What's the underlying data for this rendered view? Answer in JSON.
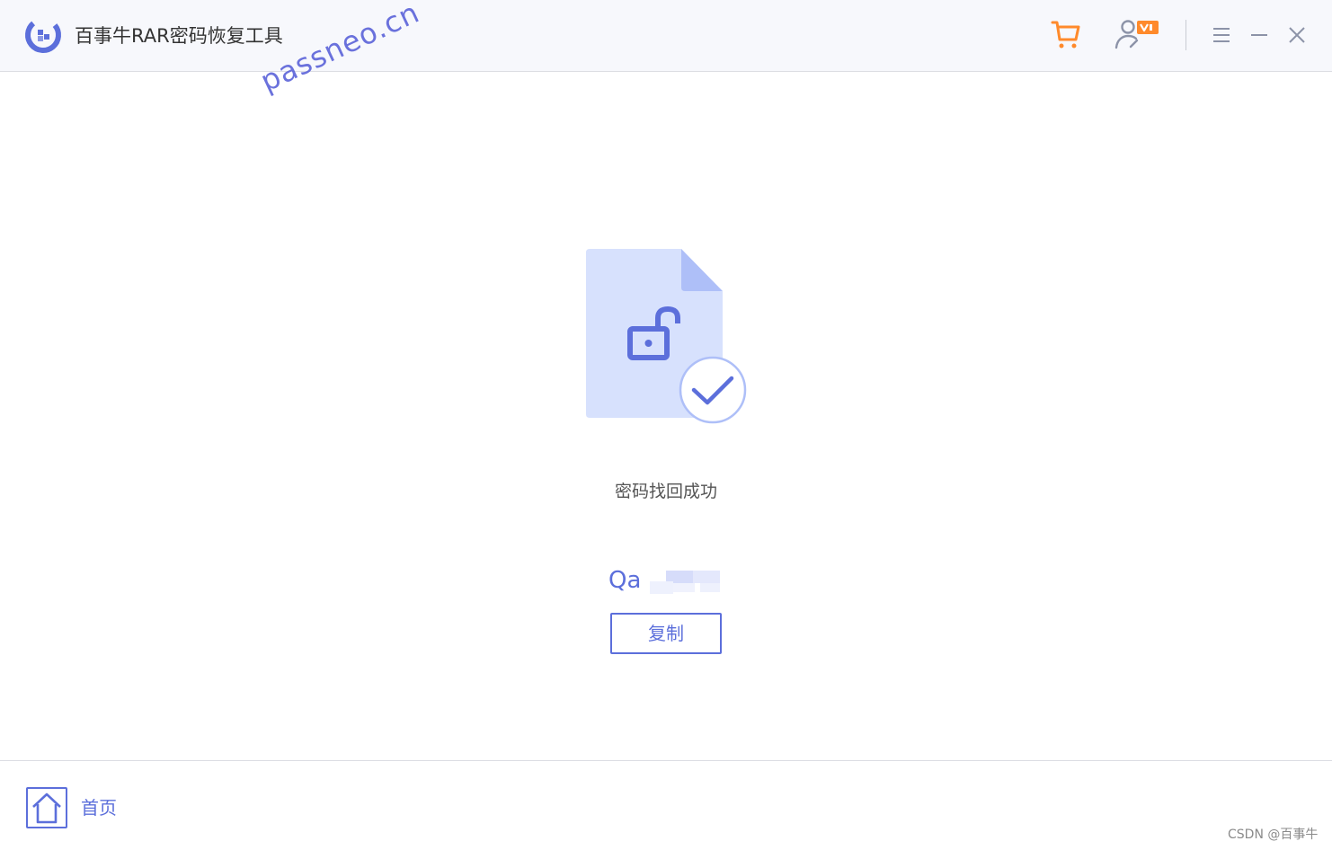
{
  "app": {
    "title": "百事牛RAR密码恢复工具",
    "brand_color": "#5c6fdb",
    "accent_color": "#ff8a2b"
  },
  "titlebar": {
    "icons": [
      "cart-icon",
      "user-vip-icon",
      "menu-icon",
      "minimize-icon",
      "close-icon"
    ]
  },
  "watermark": {
    "text": "passneo.cn"
  },
  "result": {
    "status_text": "密码找回成功",
    "password_visible": "Qa",
    "copy_label": "复制",
    "icons": [
      "unlocked-file-icon",
      "check-circle-icon"
    ]
  },
  "footer": {
    "home_label": "首页",
    "home_icon": "home-icon",
    "credit": "CSDN @百事牛"
  }
}
